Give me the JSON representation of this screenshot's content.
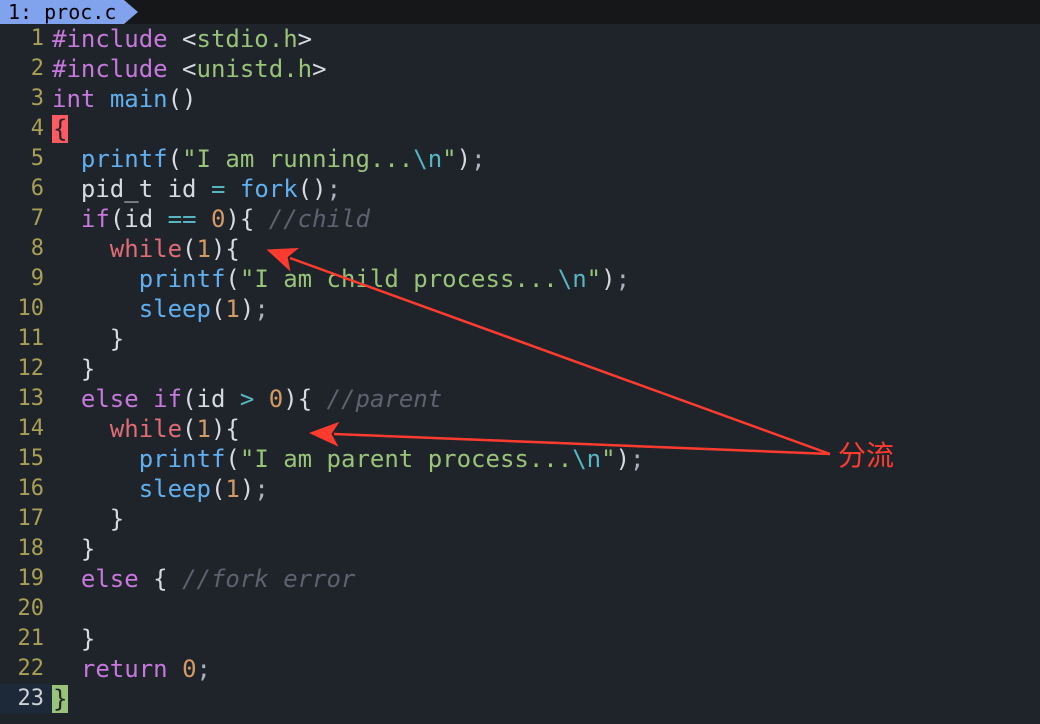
{
  "tab": {
    "label": "1: proc.c"
  },
  "annotation": {
    "text": "分流"
  },
  "lines": {
    "l1": {
      "num": "1",
      "preproc": "#include",
      "sp": " ",
      "lt": "<",
      "hdr": "stdio.h",
      "gt": ">"
    },
    "l2": {
      "num": "2",
      "preproc": "#include",
      "sp": " ",
      "lt": "<",
      "hdr": "unistd.h",
      "gt": ">"
    },
    "l3": {
      "num": "3",
      "type": "int",
      "sp": " ",
      "fn": "main",
      "paren": "()"
    },
    "l4": {
      "num": "4",
      "brace": "{"
    },
    "l5": {
      "num": "5",
      "indent": "  ",
      "fn": "printf",
      "lp": "(",
      "q1": "\"",
      "str": "I am running...",
      "esc": "\\n",
      "q2": "\"",
      "rp": ")",
      "semi": ";"
    },
    "l6": {
      "num": "6",
      "indent": "  ",
      "type": "pid_t",
      "sp": " ",
      "var": "id",
      "eq": " = ",
      "fn": "fork",
      "paren": "()",
      "semi": ";"
    },
    "l7": {
      "num": "7",
      "indent": "  ",
      "kw": "if",
      "lp": "(",
      "var": "id",
      "op": " == ",
      "val": "0",
      "rp": ")",
      "brace": "{",
      "sp": " ",
      "comment": "//child"
    },
    "l8": {
      "num": "8",
      "indent": "    ",
      "kw": "while",
      "lp": "(",
      "val": "1",
      "rp": ")",
      "brace": "{"
    },
    "l9": {
      "num": "9",
      "indent": "      ",
      "fn": "printf",
      "lp": "(",
      "q1": "\"",
      "str": "I am child process...",
      "esc": "\\n",
      "q2": "\"",
      "rp": ")",
      "semi": ";"
    },
    "l10": {
      "num": "10",
      "indent": "      ",
      "fn": "sleep",
      "lp": "(",
      "val": "1",
      "rp": ")",
      "semi": ";"
    },
    "l11": {
      "num": "11",
      "indent": "    ",
      "brace": "}"
    },
    "l12": {
      "num": "12",
      "indent": "  ",
      "brace": "}"
    },
    "l13": {
      "num": "13",
      "indent": "  ",
      "kw": "else if",
      "lp": "(",
      "var": "id",
      "op": " > ",
      "val": "0",
      "rp": ")",
      "brace": "{",
      "sp": " ",
      "comment": "//parent"
    },
    "l14": {
      "num": "14",
      "indent": "    ",
      "kw": "while",
      "lp": "(",
      "val": "1",
      "rp": ")",
      "brace": "{"
    },
    "l15": {
      "num": "15",
      "indent": "      ",
      "fn": "printf",
      "lp": "(",
      "q1": "\"",
      "str": "I am parent process...",
      "esc": "\\n",
      "q2": "\"",
      "rp": ")",
      "semi": ";"
    },
    "l16": {
      "num": "16",
      "indent": "      ",
      "fn": "sleep",
      "lp": "(",
      "val": "1",
      "rp": ")",
      "semi": ";"
    },
    "l17": {
      "num": "17",
      "indent": "    ",
      "brace": "}"
    },
    "l18": {
      "num": "18",
      "indent": "  ",
      "brace": "}"
    },
    "l19": {
      "num": "19",
      "indent": "  ",
      "kw": "else",
      "sp": " ",
      "brace": "{",
      "sp2": " ",
      "comment": "//fork error"
    },
    "l20": {
      "num": "20"
    },
    "l21": {
      "num": "21",
      "indent": "  ",
      "brace": "}"
    },
    "l22": {
      "num": "22",
      "indent": "  ",
      "kw": "return",
      "sp": " ",
      "val": "0",
      "semi": ";"
    },
    "l23": {
      "num": "23",
      "brace": "}"
    }
  }
}
